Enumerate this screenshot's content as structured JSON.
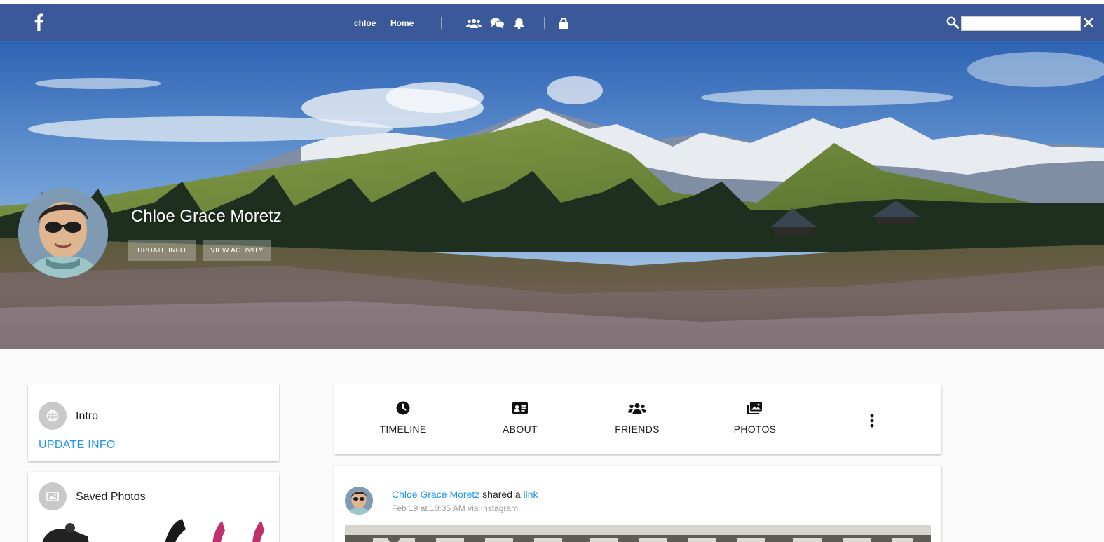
{
  "navbar": {
    "logo_icon": "facebook-f-icon",
    "user_link": "chloe",
    "home_link": "Home",
    "icons": [
      "friends-icon",
      "messages-icon",
      "notifications-bell-icon",
      "lock-icon"
    ],
    "search_placeholder": "",
    "search_icon": "search-icon",
    "close_icon": "close-icon",
    "background_color": "#3b5998"
  },
  "cover": {
    "profile_name": "Chloe Grace Moretz",
    "update_info_button": "UPDATE INFO",
    "view_activity_button": "VIEW ACTIVITY"
  },
  "intro_card": {
    "icon": "globe-icon",
    "title": "Intro",
    "update_link": "UPDATE INFO"
  },
  "saved_photos_card": {
    "icon": "image-icon",
    "title": "Saved Photos"
  },
  "profile_tabs": [
    {
      "label": "TIMELINE",
      "icon": "clock-icon"
    },
    {
      "label": "ABOUT",
      "icon": "id-card-icon"
    },
    {
      "label": "FRIENDS",
      "icon": "friends-icon"
    },
    {
      "label": "PHOTOS",
      "icon": "photos-icon"
    }
  ],
  "more_icon": "more-vertical-icon",
  "post": {
    "author": "Chloe Grace Moretz",
    "action": "shared a",
    "object": "link",
    "meta": "Feb 19 at 10:35 AM via Instagram"
  },
  "colors": {
    "link_blue": "#2196f3",
    "icon_circle": "#c9c9c9"
  }
}
